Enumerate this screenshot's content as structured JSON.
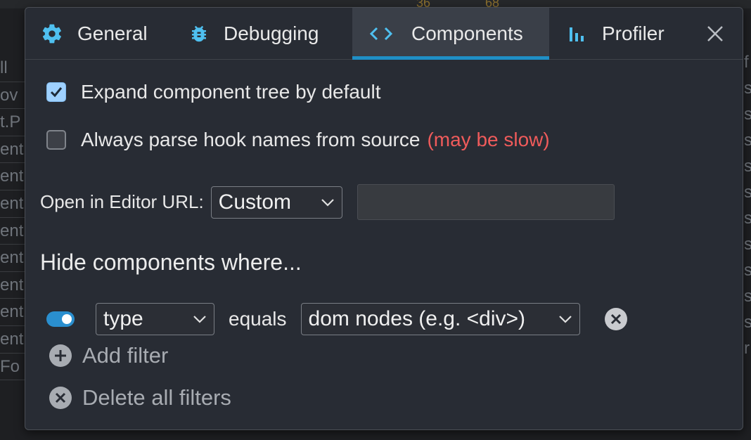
{
  "background": {
    "left_rows": [
      "ll",
      "ov",
      "t.P",
      "ent",
      "ent",
      "ent",
      "ent",
      "ent",
      "ent",
      "ent",
      "ent",
      "Fo"
    ],
    "right_rows": [
      "f",
      "s",
      "s",
      "s",
      "s",
      "s",
      "s",
      "s",
      "s",
      "s",
      "s",
      "r"
    ],
    "top_counts": [
      "36",
      "68"
    ]
  },
  "tabs": [
    {
      "label": "General",
      "icon": "gear-icon",
      "selected": false
    },
    {
      "label": "Debugging",
      "icon": "bug-icon",
      "selected": false
    },
    {
      "label": "Components",
      "icon": "code-brackets-icon",
      "selected": true
    },
    {
      "label": "Profiler",
      "icon": "bar-chart-icon",
      "selected": false
    }
  ],
  "close_icon": "close-icon",
  "settings": {
    "expand_tree": {
      "label": "Expand component tree by default",
      "checked": true
    },
    "parse_hooks": {
      "label": "Always parse hook names from source",
      "warning": "(may be slow)",
      "checked": false
    },
    "editor": {
      "label": "Open in Editor URL:",
      "selected": "Custom",
      "url_value": ""
    }
  },
  "hide_section": {
    "title": "Hide components where...",
    "filter": {
      "enabled": true,
      "field": "type",
      "operator": "equals",
      "value": "dom nodes (e.g. <div>)"
    },
    "add_filter": "Add filter",
    "delete_all": "Delete all filters"
  },
  "colors": {
    "accent": "#1f8fc6",
    "warning": "#ef5b5b",
    "panel": "#282c34"
  }
}
